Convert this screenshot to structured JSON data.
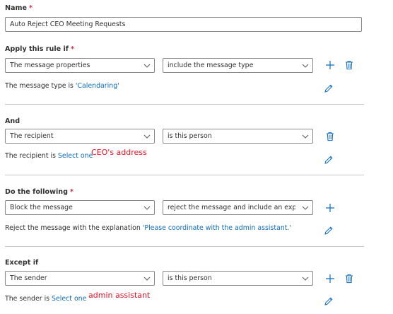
{
  "name": {
    "label": "Name",
    "required": "*",
    "value": "Auto Reject CEO Meeting Requests"
  },
  "apply": {
    "label": "Apply this rule if",
    "required": "*",
    "property": "The message properties",
    "condition": "include the message type",
    "desc_prefix": "The message type is ",
    "desc_value": "'Calendaring'"
  },
  "and": {
    "label": "And",
    "property": "The recipient",
    "condition": "is this person",
    "desc_prefix": "The recipient is ",
    "desc_value": "Select one",
    "annotation": "CEO's address"
  },
  "do": {
    "label": "Do the following",
    "required": "*",
    "action": "Block the message",
    "condition": "reject the message and include an exp...",
    "desc_prefix": "Reject the message with the explanation ",
    "desc_value": "'Please coordinate with the admin assistant.'"
  },
  "except": {
    "label": "Except if",
    "property": "The sender",
    "condition": "is this person",
    "desc_prefix": "The sender is ",
    "desc_value": "Select one",
    "annotation": "admin assistant"
  },
  "colors": {
    "accent": "#0f6cbd",
    "required": "#c4314b",
    "annotation": "#e81123",
    "border": "#8a8886"
  }
}
